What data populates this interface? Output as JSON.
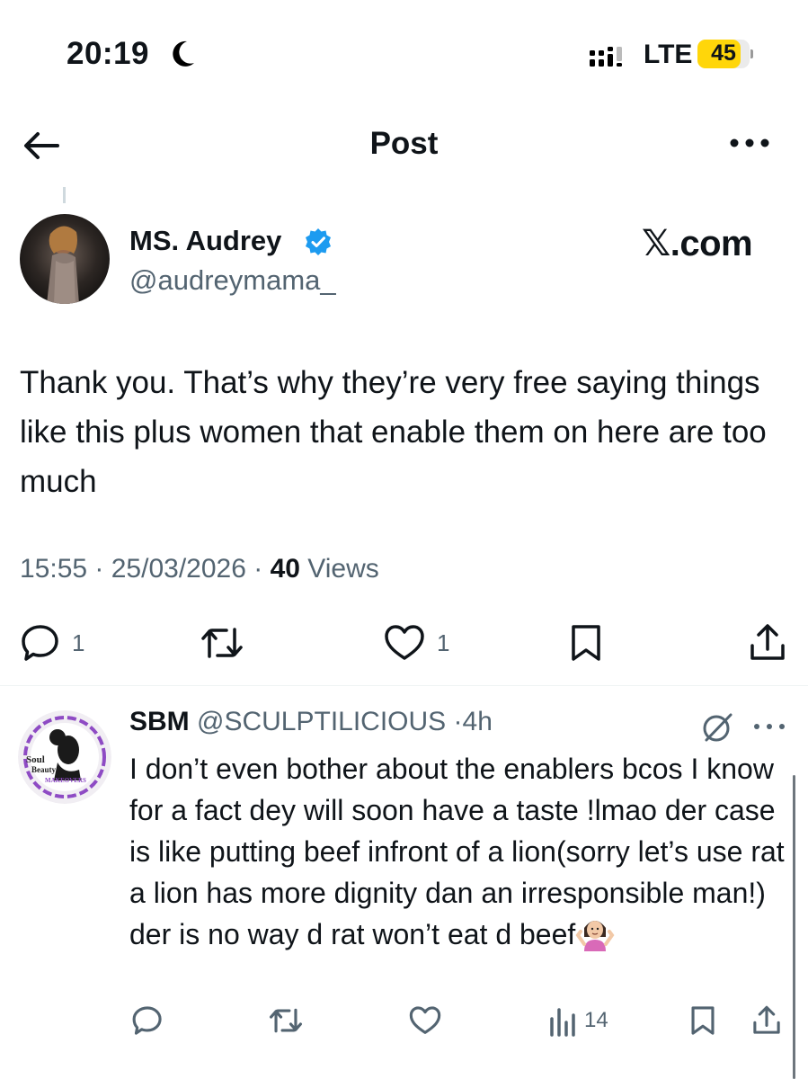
{
  "status_bar": {
    "time": "20:19",
    "network": "LTE",
    "battery": "45",
    "battery_color": "#ffd60a",
    "icons": [
      "moon-icon",
      "signal-icon",
      "battery-icon"
    ]
  },
  "header": {
    "title": "Post",
    "icons": [
      "back-arrow-icon",
      "more-icon"
    ]
  },
  "post": {
    "author_name": "MS. Audrey",
    "author_handle": "@audreymama_",
    "verified": true,
    "verified_color": "#1d9bf0",
    "watermark": "𝕏.com",
    "text": "Thank you. That’s why they’re very free saying things like this plus women that enable them on here are too much",
    "time": "15:55",
    "date": "25/03/2026",
    "separator": "·",
    "views_count": "40",
    "views_label": "Views",
    "actions": {
      "replies": "1",
      "likes": "1",
      "icons": [
        "reply-icon",
        "repost-icon",
        "like-icon",
        "bookmark-icon",
        "share-icon"
      ]
    }
  },
  "reply": {
    "name": "SBM",
    "handle": "@SCULPTILICIOUS",
    "separator": "·",
    "time": "4h",
    "avatar_text": [
      "Soul",
      "Beauty",
      "MAKEOVERS"
    ],
    "avatar_color": "#8e4bc4",
    "text": "I don’t even bother about the enablers bcos I know for a fact dey will soon have a taste !lmao der case is like putting beef infront of a lion(sorry let’s use rat a lion has more dignity dan an irresponsible man!) der is no way d rat won’t eat d beef",
    "emoji": "shrug-emoji",
    "actions": {
      "views": "14",
      "icons": [
        "reply-icon",
        "repost-icon",
        "like-icon",
        "views-icon",
        "bookmark-icon",
        "share-icon"
      ]
    }
  }
}
